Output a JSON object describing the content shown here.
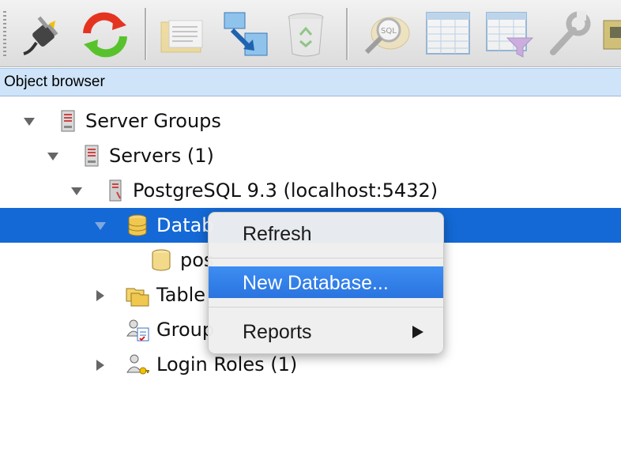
{
  "toolbar": {
    "buttons": [
      {
        "name": "connect-plug-icon"
      },
      {
        "name": "refresh-icon"
      },
      {
        "name": "properties-folder-icon"
      },
      {
        "name": "create-object-icon"
      },
      {
        "name": "delete-trash-icon"
      },
      {
        "name": "sql-query-icon",
        "label": "SQL"
      },
      {
        "name": "view-data-icon"
      },
      {
        "name": "filtered-data-icon"
      },
      {
        "name": "tools-wrench-icon"
      },
      {
        "name": "plugin-icon"
      }
    ]
  },
  "panel": {
    "title": "Object browser"
  },
  "tree": {
    "items": [
      {
        "label": "Server Groups"
      },
      {
        "label": "Servers (1)"
      },
      {
        "label": "PostgreSQL 9.3 (localhost:5432)"
      },
      {
        "label": "Datab"
      },
      {
        "label": "pos"
      },
      {
        "label": "Table"
      },
      {
        "label": "Group"
      },
      {
        "label": "Login Roles (1)"
      }
    ]
  },
  "context_menu": {
    "items": [
      {
        "label": "Refresh"
      },
      {
        "label": "New Database..."
      },
      {
        "label": "Reports"
      }
    ]
  },
  "colors": {
    "selection": "#1469d6",
    "menu_highlight": "#3184ea",
    "panel_header": "#cfe4f9"
  }
}
